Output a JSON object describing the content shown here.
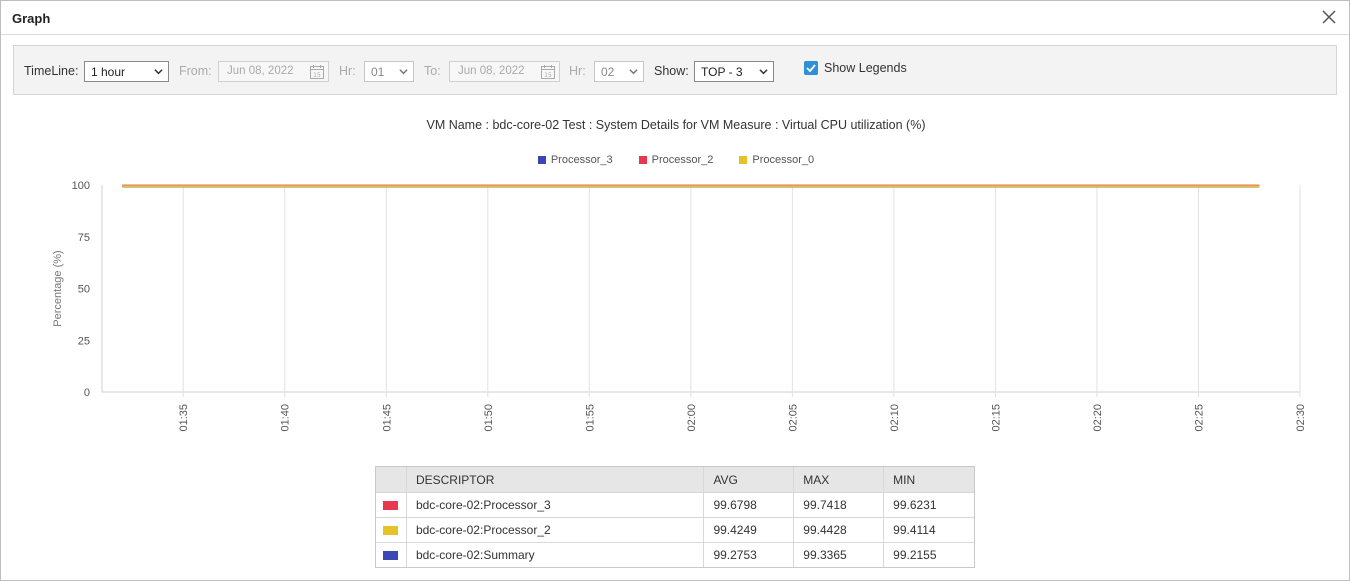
{
  "window": {
    "title": "Graph"
  },
  "toolbar": {
    "timeline_label": "TimeLine:",
    "timeline_value": "1 hour",
    "from_label": "From:",
    "from_date": "Jun 08, 2022",
    "from_hr_label": "Hr:",
    "from_hr_value": "01",
    "to_label": "To:",
    "to_date": "Jun 08, 2022",
    "to_hr_label": "Hr:",
    "to_hr_value": "02",
    "show_label": "Show:",
    "show_value": "TOP - 3",
    "show_legends_label": "Show Legends",
    "show_legends_checked": true
  },
  "chart_title": "VM Name : bdc-core-02 Test : System Details for VM Measure : Virtual CPU utilization (%)",
  "chart_data": {
    "type": "line",
    "title": "VM Name : bdc-core-02 Test : System Details for VM Measure : Virtual CPU utilization (%)",
    "xlabel": "",
    "ylabel": "Percentage (%)",
    "ylim": [
      0,
      100
    ],
    "yticks": [
      "0",
      "25",
      "50",
      "75",
      "100"
    ],
    "xticks": [
      "01:35",
      "01:40",
      "01:45",
      "01:50",
      "01:55",
      "02:00",
      "02:05",
      "02:10",
      "02:15",
      "02:20",
      "02:25",
      "02:30"
    ],
    "x_range": [
      "01:31",
      "02:30"
    ],
    "x": [
      "01:32",
      "02:28"
    ],
    "legend_position": "top-center",
    "grid": "vertical",
    "series": [
      {
        "name": "Processor_3",
        "color": "#3b47b5",
        "values": [
          99.3,
          99.3
        ]
      },
      {
        "name": "Processor_2",
        "color": "#e8384f",
        "values": [
          99.7,
          99.7
        ]
      },
      {
        "name": "Processor_0",
        "color": "#e6c229",
        "values": [
          99.4,
          99.4
        ]
      }
    ]
  },
  "table": {
    "headers": [
      "DESCRIPTOR",
      "AVG",
      "MAX",
      "MIN"
    ],
    "rows": [
      {
        "color": "#e8384f",
        "descriptor": "bdc-core-02:Processor_3",
        "avg": "99.6798",
        "max": "99.7418",
        "min": "99.6231"
      },
      {
        "color": "#e6c229",
        "descriptor": "bdc-core-02:Processor_2",
        "avg": "99.4249",
        "max": "99.4428",
        "min": "99.4114"
      },
      {
        "color": "#3b47b5",
        "descriptor": "bdc-core-02:Summary",
        "avg": "99.2753",
        "max": "99.3365",
        "min": "99.2155"
      }
    ]
  }
}
